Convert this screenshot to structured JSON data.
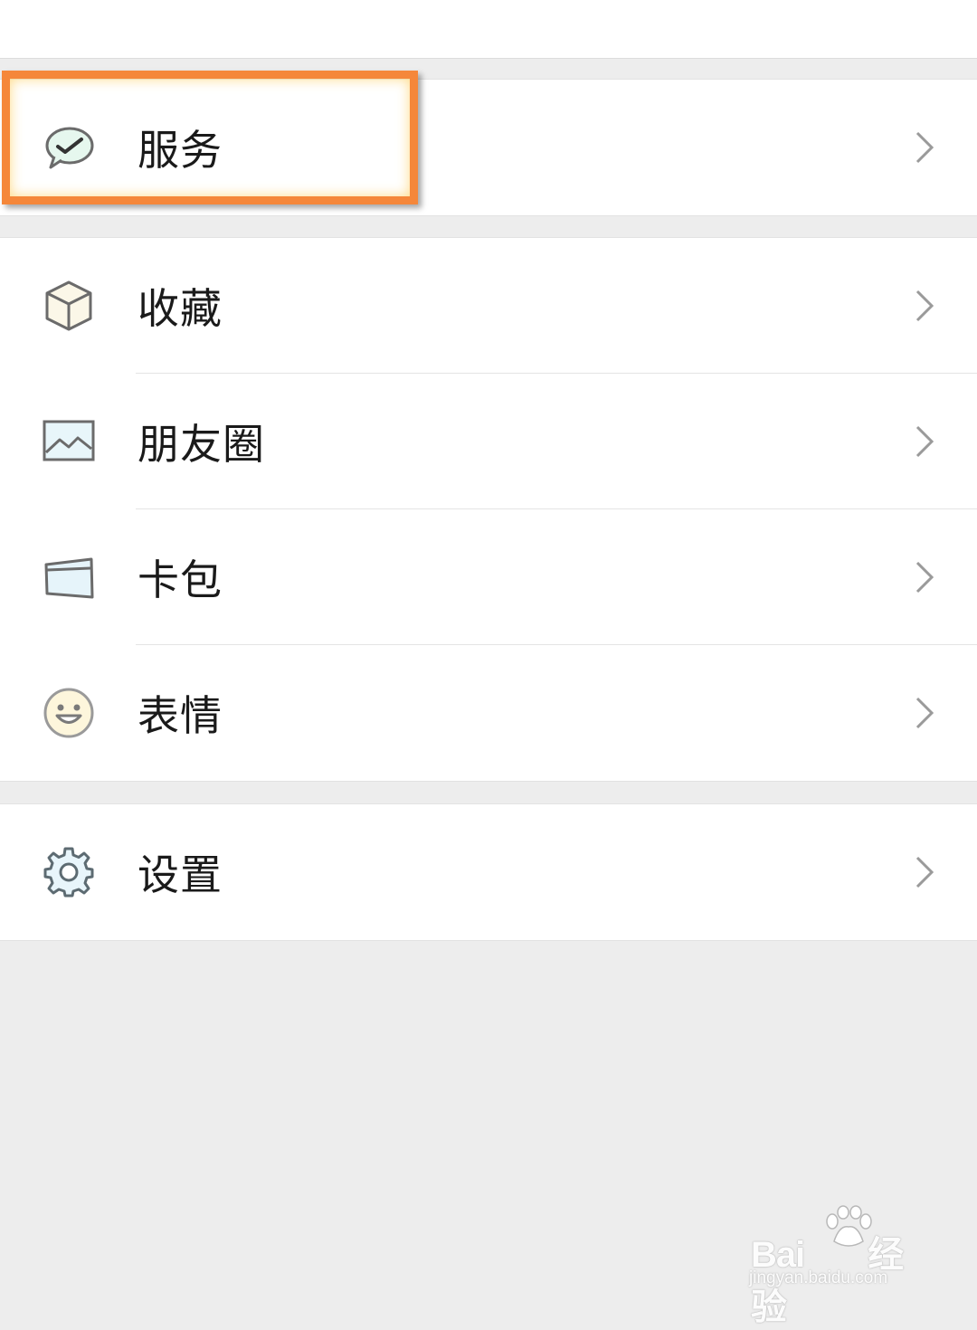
{
  "menu_groups": [
    {
      "items": [
        {
          "label": "服务",
          "icon": "wechat-pay-check-icon"
        }
      ]
    },
    {
      "items": [
        {
          "label": "收藏",
          "icon": "cube-icon"
        },
        {
          "label": "朋友圈",
          "icon": "picture-icon"
        },
        {
          "label": "卡包",
          "icon": "card-wallet-icon"
        },
        {
          "label": "表情",
          "icon": "smiley-icon"
        }
      ]
    },
    {
      "items": [
        {
          "label": "设置",
          "icon": "gear-icon"
        }
      ]
    }
  ],
  "highlight": {
    "target": "服务",
    "color": "#f5873a"
  },
  "watermark": {
    "brand": "Bai",
    "brand_suffix": "经验",
    "url": "jingyan.baidu.com"
  },
  "colors": {
    "background": "#ededed",
    "row": "#ffffff",
    "text": "#1a1a1a",
    "chevron": "#9a9a9a"
  }
}
